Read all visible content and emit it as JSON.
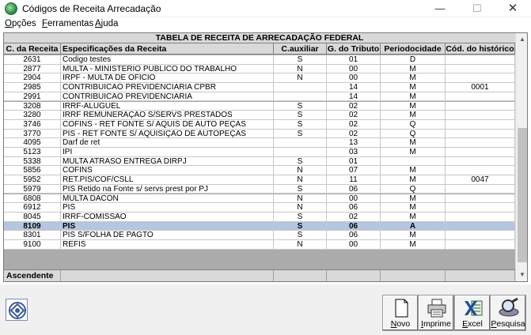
{
  "window": {
    "title": "Códigos de Receita Arrecadação",
    "controls": {
      "minimize": "—",
      "maximize": "☐",
      "close": "✕"
    }
  },
  "menu": [
    {
      "key": "O",
      "rest": "pções"
    },
    {
      "key": "F",
      "rest": "erramentas"
    },
    {
      "key": "A",
      "rest": "juda"
    }
  ],
  "grid": {
    "caption": "TABELA DE RECEITA DE ARRECADAÇÃO FEDERAL",
    "columns": [
      "C. da Receita",
      "Especificações da Receita",
      "C.auxiliar",
      "G. do Tributo",
      "Periodocidade",
      "Cód. do histórico"
    ],
    "rows": [
      [
        "2631",
        "Codigo testes",
        "S",
        "01",
        "D",
        ""
      ],
      [
        "2877",
        "MULTA - MINISTERIO PUBLICO DO TRABALHO",
        "N",
        "00",
        "M",
        ""
      ],
      [
        "2904",
        "IRPF - MULTA DE OFÍCIO",
        "N",
        "00",
        "M",
        ""
      ],
      [
        "2985",
        "CONTRIBUICAO PREVIDENCIARIA CPBR",
        "",
        "14",
        "M",
        "0001"
      ],
      [
        "2991",
        "CONTRIBUICAO PREVIDENCIARIA",
        "",
        "14",
        "M",
        ""
      ],
      [
        "3208",
        "IRRF-ALUGUEL",
        "S",
        "02",
        "M",
        ""
      ],
      [
        "3280",
        "IRRF REMUNERAÇÃO S/SERVS PRESTADOS",
        "S",
        "02",
        "M",
        ""
      ],
      [
        "3746",
        "COFINS - RET FONTE S/ AQUIS DE AUTO PEÇAS",
        "S",
        "02",
        "Q",
        ""
      ],
      [
        "3770",
        "PIS - RET FONTE S/ AQUISIÇÃO DE AUTOPEÇAS",
        "S",
        "02",
        "Q",
        ""
      ],
      [
        "4095",
        "Darf de   ret",
        "",
        "13",
        "M",
        ""
      ],
      [
        "5123",
        "IPI",
        "",
        "03",
        "M",
        ""
      ],
      [
        "5338",
        "MULTA ATRASO ENTREGA DIRPJ",
        "S",
        "01",
        "",
        ""
      ],
      [
        "5856",
        "COFINS",
        "N",
        "07",
        "M",
        ""
      ],
      [
        "5952",
        "RET.PIS/COF/CSLL",
        "N",
        "11",
        "M",
        "0047"
      ],
      [
        "5979",
        "PIS Retido na Fonte s/ servs prest por PJ",
        "S",
        "06",
        "Q",
        ""
      ],
      [
        "6808",
        "MULTA DACON",
        "N",
        "00",
        "M",
        ""
      ],
      [
        "6912",
        "PIS",
        "N",
        "06",
        "M",
        ""
      ],
      [
        "8045",
        "IRRF-COMISSÃO",
        "S",
        "02",
        "M",
        ""
      ],
      [
        "8109",
        "PIS",
        "S",
        "06",
        "A",
        ""
      ],
      [
        "8301",
        "PIS S/FOLHA DE PAGTO",
        "S",
        "06",
        "M",
        ""
      ],
      [
        "9100",
        "REFIS",
        "N",
        "00",
        "M",
        ""
      ]
    ],
    "selected_index": 18,
    "footer_label": "Ascendente"
  },
  "scroll": {
    "up": "▲",
    "down": "▼"
  },
  "buttons": {
    "novo": {
      "key": "N",
      "rest": "ovo"
    },
    "imprime": {
      "key": "I",
      "rest": "mprime"
    },
    "excel": {
      "key": "E",
      "rest": "xcel"
    },
    "pesquisa": {
      "key": "P",
      "rest": "esquisa"
    }
  }
}
